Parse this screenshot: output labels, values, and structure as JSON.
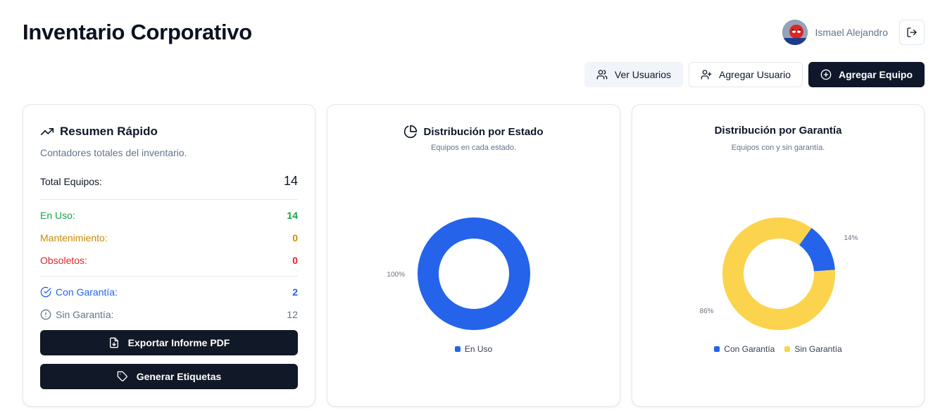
{
  "header": {
    "title": "Inventario Corporativo",
    "user_name": "Ismael Alejandro"
  },
  "actions": {
    "view_users": "Ver Usuarios",
    "add_user": "Agregar Usuario",
    "add_equipment": "Agregar Equipo"
  },
  "summary": {
    "title": "Resumen Rápido",
    "subtitle": "Contadores totales del inventario.",
    "total_label": "Total Equipos:",
    "total_value": "14",
    "in_use_label": "En Uso:",
    "in_use_value": "14",
    "maintenance_label": "Mantenimiento:",
    "maintenance_value": "0",
    "obsolete_label": "Obsoletos:",
    "obsolete_value": "0",
    "warranty_label": "Con Garantía:",
    "warranty_value": "2",
    "no_warranty_label": "Sin Garantía:",
    "no_warranty_value": "12",
    "export_pdf": "Exportar Informe PDF",
    "generate_labels": "Generar Etiquetas"
  },
  "colors": {
    "blue": "#2563eb",
    "yellow": "#fcd34d",
    "green": "#16a34a",
    "amber": "#ca8a04",
    "red": "#dc2626",
    "dark": "#0f172a"
  },
  "chart_data": [
    {
      "type": "pie",
      "title": "Distribución por Estado",
      "subtitle": "Equipos en cada estado.",
      "categories": [
        "En Uso"
      ],
      "values": [
        100
      ],
      "labels": [
        "100%"
      ],
      "colors": [
        "#2563eb"
      ],
      "legend": "bottom"
    },
    {
      "type": "pie",
      "title": "Distribución por Garantía",
      "subtitle": "Equipos con y sin garantía.",
      "categories": [
        "Con Garantía",
        "Sin Garantía"
      ],
      "values": [
        14,
        86
      ],
      "labels": [
        "14%",
        "86%"
      ],
      "colors": [
        "#2563eb",
        "#fcd34d"
      ],
      "legend": "bottom"
    }
  ]
}
